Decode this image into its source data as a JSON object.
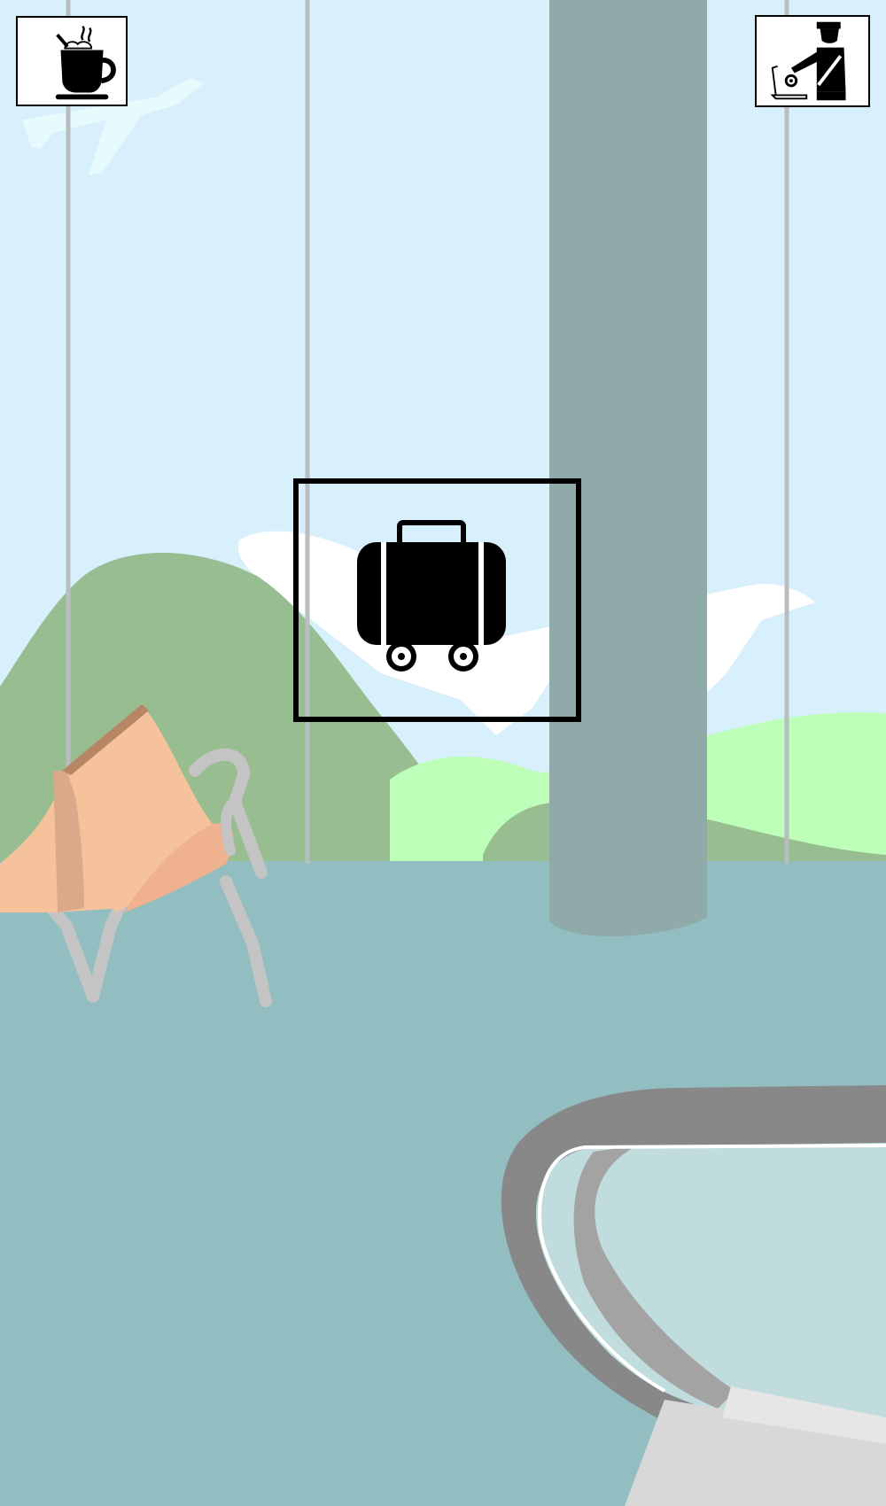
{
  "scene": {
    "name": "airport-departure-lounge",
    "colors": {
      "sky": "#d8effc",
      "floor": "#92bec2",
      "pillar": "#8faaa9",
      "hill_dark": "#97bd90",
      "hill_light": "#bdffb9",
      "airplane": "#ffffff",
      "window_frame": "#b8bec0",
      "chair_seat": "#f5c29c",
      "chair_frame": "#c4c4c4",
      "foreground_rail": "#888888",
      "foreground_surface": "#c0dcdd"
    }
  },
  "hud": {
    "top_left_button": {
      "icon": "coffee-cup-icon",
      "target": "cafe"
    },
    "top_right_button": {
      "icon": "security-officer-icon",
      "target": "security-check"
    }
  },
  "center_sign": {
    "icon": "rolling-suitcase-icon",
    "target": "baggage"
  }
}
